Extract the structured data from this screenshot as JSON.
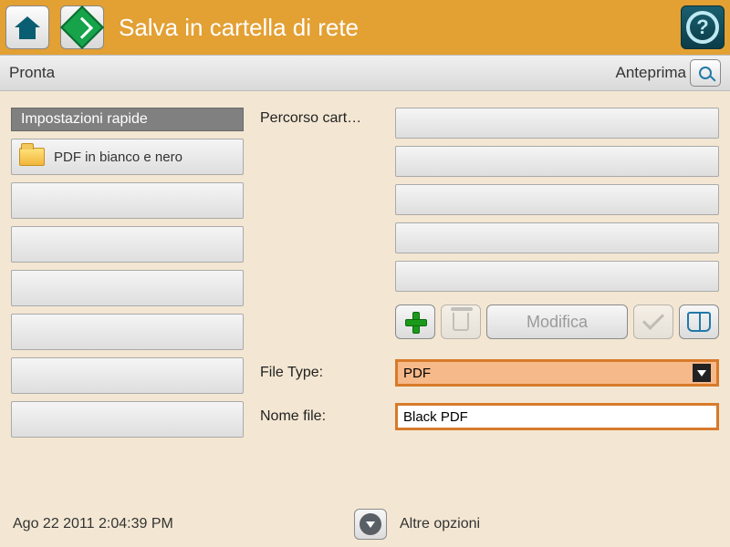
{
  "titlebar": {
    "title": "Salva in cartella di rete"
  },
  "status": {
    "text": "Pronta",
    "preview_label": "Anteprima"
  },
  "quicksettings": {
    "heading": "Impostazioni rapide",
    "items": [
      "PDF in bianco e nero"
    ]
  },
  "form": {
    "path_label": "Percorso cart…",
    "modify_label": "Modifica",
    "filetype_label": "File Type:",
    "filetype_value": "PDF",
    "filename_label": "Nome file:",
    "filename_value": "Black PDF"
  },
  "footer": {
    "timestamp": "Ago 22 2011 2:04:39 PM",
    "more_label": "Altre opzioni"
  }
}
